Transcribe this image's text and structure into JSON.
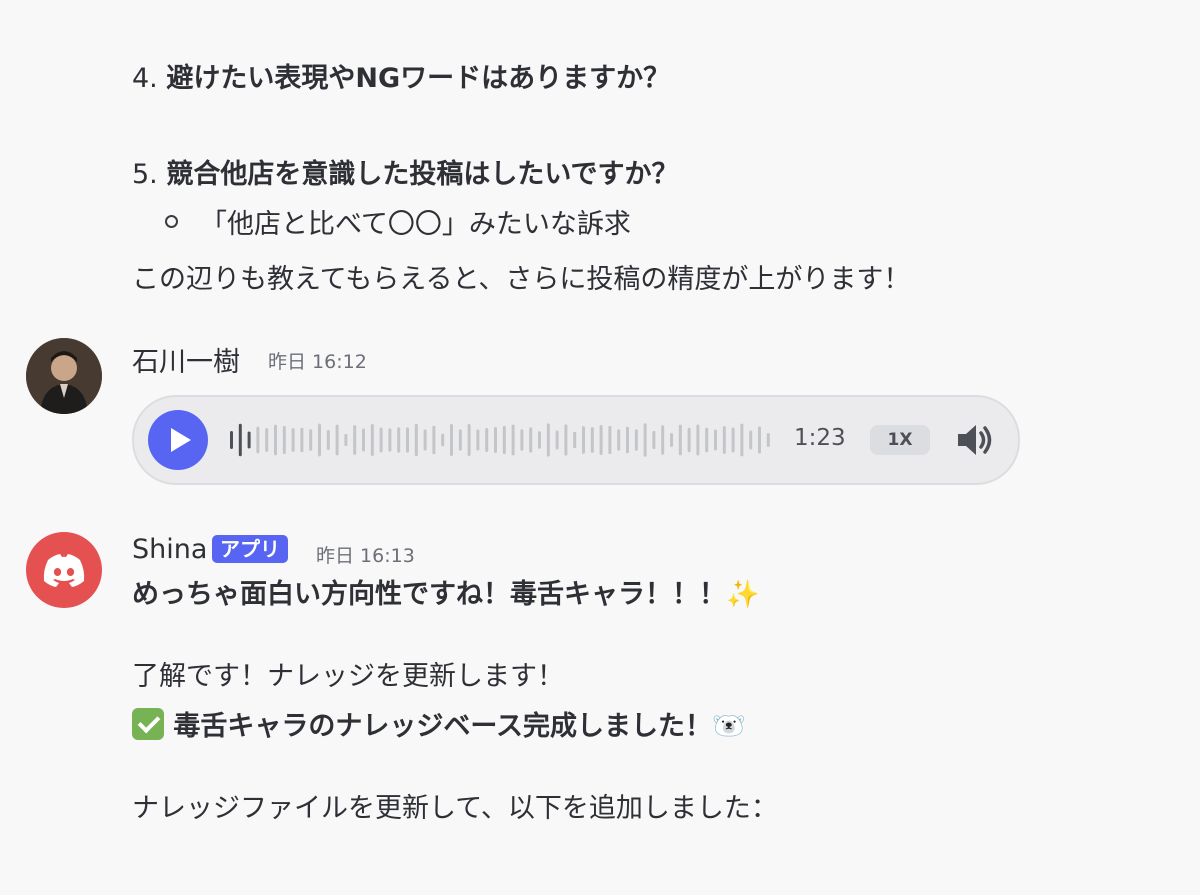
{
  "prev_message": {
    "q4_number": "4.",
    "q4_text": "避けたい表現やNGワードはありますか？",
    "q5_number": "5.",
    "q5_text": "競合他店を意識した投稿はしたいですか？",
    "q5_sub": "「他店と比べて〇〇」みたいな訴求",
    "closing": "この辺りも教えてもらえると、さらに投稿の精度が上がります！"
  },
  "message_voice": {
    "author": "石川一樹",
    "timestamp": "昨日 16:12",
    "voice": {
      "duration": "1:23",
      "speed": "1X",
      "progress": 0.0
    }
  },
  "message_bot": {
    "author": "Shina",
    "badge": "アプリ",
    "timestamp": "昨日 16:13",
    "line1": "めっちゃ面白い方向性ですね！毒舌キャラ！！！✨",
    "line2": "了解です！ナレッジを更新します！",
    "line3": "毒舌キャラのナレッジベース完成しました！🐻‍❄️",
    "line4": "ナレッジファイルを更新して、以下を追加しました："
  },
  "colors": {
    "accent": "#5865f2",
    "bot_avatar": "#e55151",
    "check": "#77b255"
  },
  "icons": [
    "play-icon",
    "waveform-icon",
    "volume-icon",
    "discord-logo-icon",
    "check-emoji-icon",
    "sparkles-emoji",
    "polar-bear-emoji"
  ]
}
